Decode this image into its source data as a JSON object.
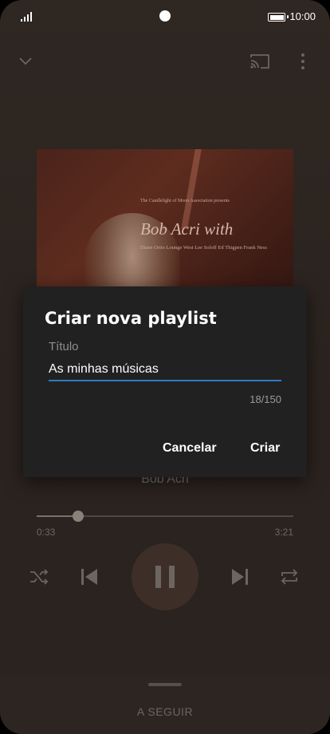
{
  "status_bar": {
    "time": "10:00"
  },
  "album_art": {
    "small_credit": "The Candlelight of Moon Association presents",
    "title_text": "Bob Acri with",
    "personnel": "Diane Orito Lounge West Lee Soloff  Ed Thigpen Frank Ness"
  },
  "player": {
    "artist": "Bob Acri",
    "elapsed": "0:33",
    "duration": "3:21",
    "progress_fraction": 0.162
  },
  "up_next": {
    "label": "A SEGUIR"
  },
  "dialog": {
    "title": "Criar nova playlist",
    "field_label": "Título",
    "field_value": "As minhas músicas",
    "counter": "18/150",
    "cancel_label": "Cancelar",
    "create_label": "Criar"
  },
  "icons": {
    "collapse": "chevron-down-icon",
    "cast": "cast-icon",
    "more": "more-vert-icon",
    "shuffle": "shuffle-icon",
    "previous": "skip-previous-icon",
    "play_pause": "pause-icon",
    "next": "skip-next-icon",
    "repeat": "repeat-icon"
  },
  "colors": {
    "accent": "#2d7ac4",
    "dialog_bg": "#212121"
  }
}
